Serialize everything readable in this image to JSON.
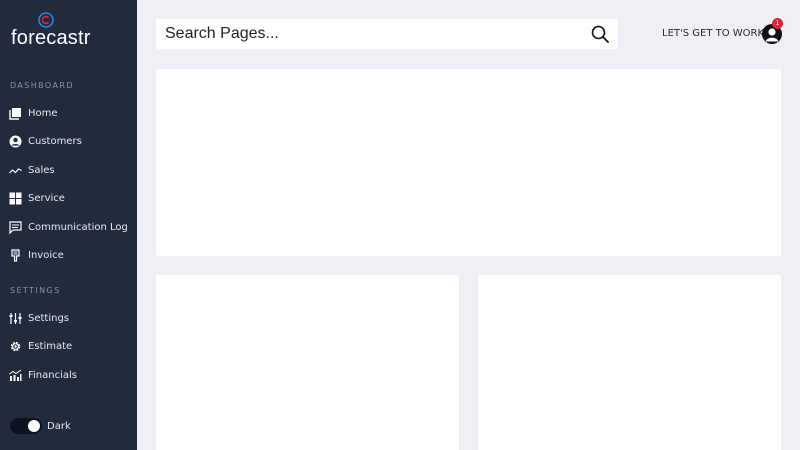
{
  "brand": {
    "name": "forecastr",
    "accent": "#1e88e5",
    "accent_inner": "#e0243b"
  },
  "sidebar": {
    "sections": [
      {
        "label": "DASHBOARD"
      },
      {
        "label": "SETTINGS"
      }
    ],
    "items": [
      {
        "label": "Home",
        "icon": "home-icon"
      },
      {
        "label": "Customers",
        "icon": "user-circle-icon"
      },
      {
        "label": "Sales",
        "icon": "trend-line-icon"
      },
      {
        "label": "Service",
        "icon": "grid-icon"
      },
      {
        "label": "Communication Log",
        "icon": "message-icon"
      },
      {
        "label": "Invoice",
        "icon": "receipt-icon"
      },
      {
        "label": "Settings",
        "icon": "sliders-icon"
      },
      {
        "label": "Estimate",
        "icon": "gear-icon"
      },
      {
        "label": "Financials",
        "icon": "bar-chart-icon"
      }
    ],
    "theme_toggle": {
      "label": "Dark",
      "state": "on"
    }
  },
  "header": {
    "search": {
      "placeholder": "Search Pages...",
      "value": ""
    },
    "cta_label": "LET'S GET TO WORK",
    "notification_count": "1"
  },
  "colors": {
    "sidebar_bg": "#222b3d",
    "page_bg": "#eff0f5",
    "badge": "#e0243b"
  }
}
